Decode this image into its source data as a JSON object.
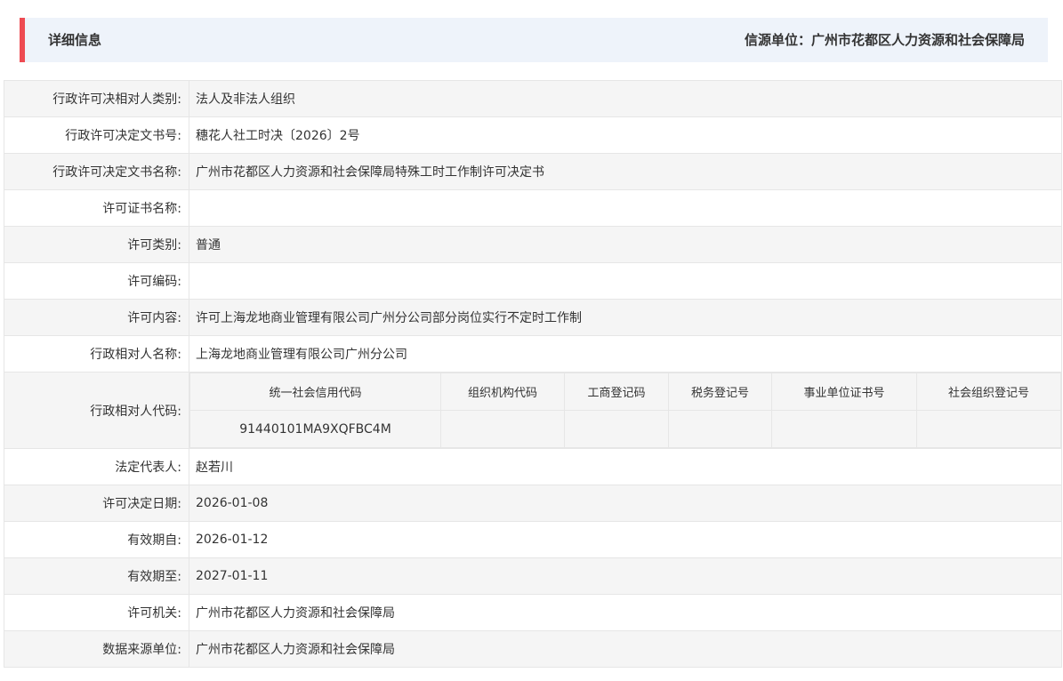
{
  "header": {
    "title": "详细信息",
    "source": "信源单位：广州市花都区人力资源和社会保障局"
  },
  "colors": {
    "accent": "#ee4b52",
    "header_bg": "#eef3fa",
    "stripe": "#f5f5f5",
    "border": "#e6e6e6"
  },
  "rows": [
    {
      "label": "行政许可决相对人类别:",
      "value": "法人及非法人组织"
    },
    {
      "label": "行政许可决定文书号:",
      "value": "穗花人社工时决〔2026〕2号"
    },
    {
      "label": "行政许可决定文书名称:",
      "value": "广州市花都区人力资源和社会保障局特殊工时工作制许可决定书"
    },
    {
      "label": "许可证书名称:",
      "value": ""
    },
    {
      "label": "许可类别:",
      "value": "普通"
    },
    {
      "label": "许可编码:",
      "value": ""
    },
    {
      "label": "许可内容:",
      "value": "许可上海龙地商业管理有限公司广州分公司部分岗位实行不定时工作制"
    },
    {
      "label": "行政相对人名称:",
      "value": "上海龙地商业管理有限公司广州分公司"
    }
  ],
  "codes": {
    "label": "行政相对人代码:",
    "headers": [
      "统一社会信用代码",
      "组织机构代码",
      "工商登记码",
      "税务登记号",
      "事业单位证书号",
      "社会组织登记号"
    ],
    "values": [
      "91440101MA9XQFBC4M",
      "",
      "",
      "",
      "",
      ""
    ]
  },
  "rows2": [
    {
      "label": "法定代表人:",
      "value": "赵若川"
    },
    {
      "label": "许可决定日期:",
      "value": "2026-01-08"
    },
    {
      "label": "有效期自:",
      "value": "2026-01-12"
    },
    {
      "label": "有效期至:",
      "value": "2027-01-11"
    },
    {
      "label": "许可机关:",
      "value": "广州市花都区人力资源和社会保障局"
    },
    {
      "label": "数据来源单位:",
      "value": "广州市花都区人力资源和社会保障局"
    }
  ]
}
